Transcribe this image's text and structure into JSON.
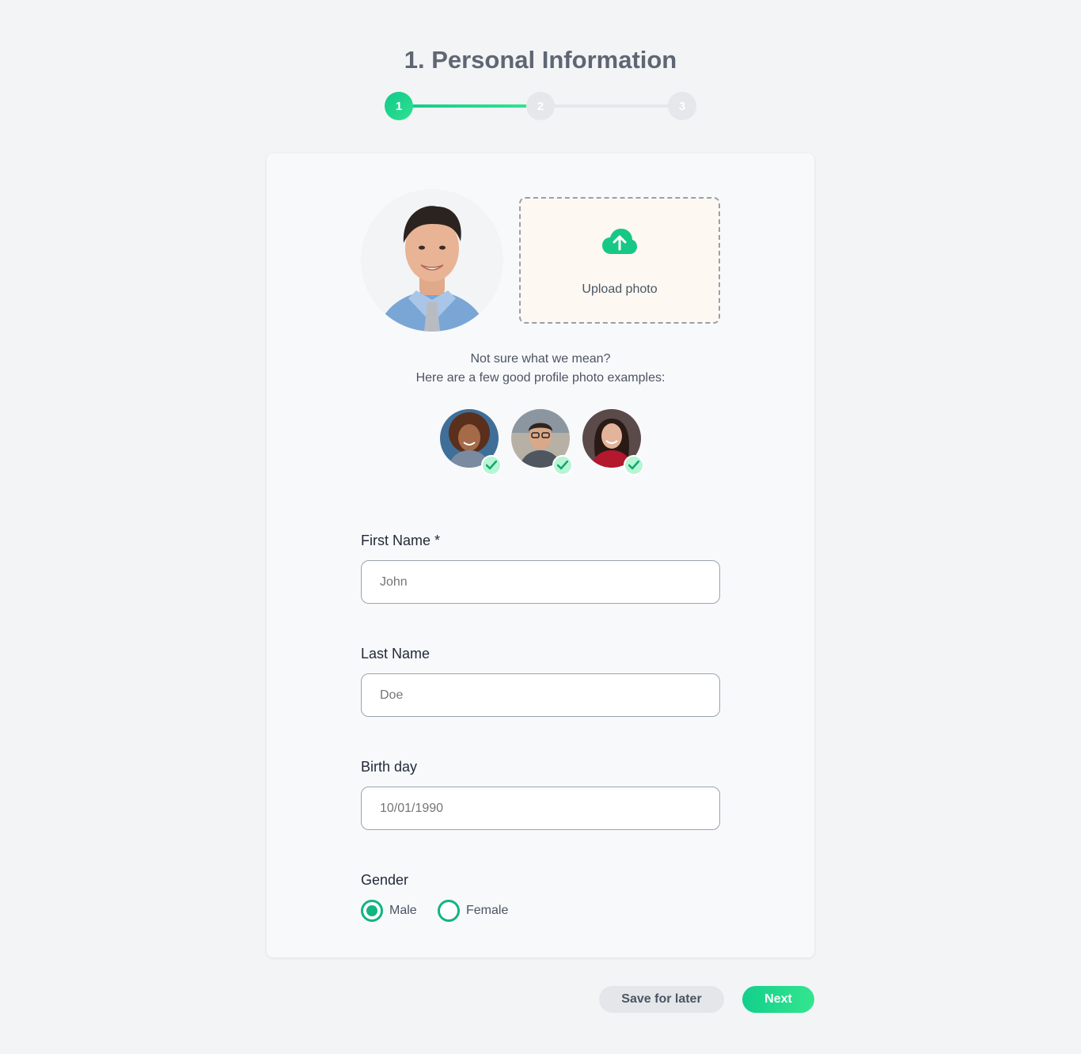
{
  "page": {
    "title": "1. Personal Information"
  },
  "stepper": {
    "steps": [
      "1",
      "2",
      "3"
    ],
    "active_step": 1,
    "accent_color": "#12c98a"
  },
  "photo": {
    "upload_label": "Upload photo",
    "upload_icon": "cloud-upload-icon",
    "hint_line1": "Not sure what we mean?",
    "hint_line2": "Here are a few good profile photo examples:",
    "example_badge_icon": "check-icon"
  },
  "form": {
    "first_name_label": "First Name *",
    "first_name_placeholder": "John",
    "last_name_label": "Last Name",
    "last_name_placeholder": "Doe",
    "birthday_label": "Birth day",
    "birthday_placeholder": "10/01/1990",
    "gender_label": "Gender",
    "gender_options": [
      "Male",
      "Female"
    ],
    "gender_selected": "Male"
  },
  "actions": {
    "save_label": "Save for later",
    "next_label": "Next"
  }
}
